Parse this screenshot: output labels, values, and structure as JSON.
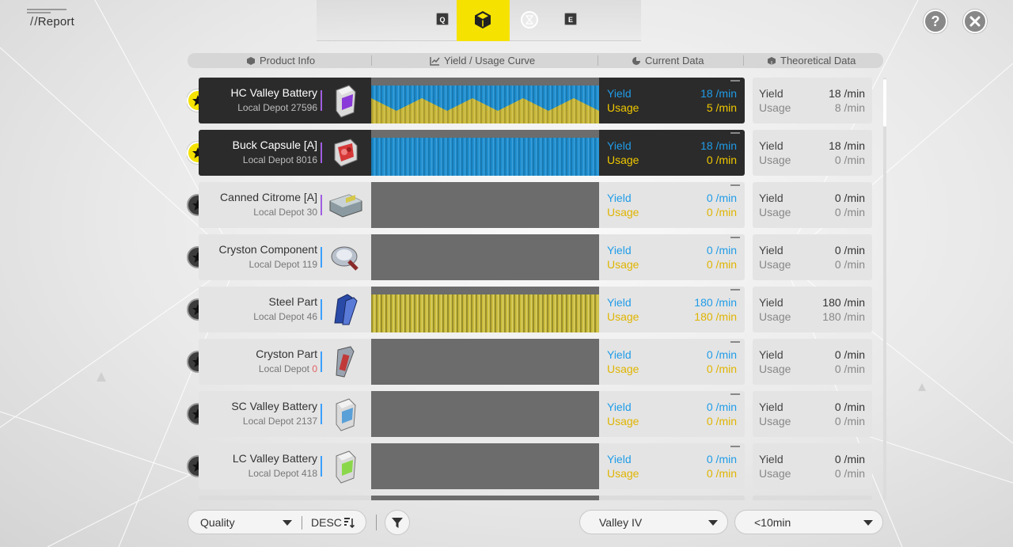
{
  "header": {
    "title": "/Report",
    "tabs": [
      {
        "key": "Q",
        "icon": "key-hint-q"
      },
      {
        "icon": "cube-icon",
        "active": true
      },
      {
        "icon": "hourglass-icon"
      },
      {
        "key": "E",
        "icon": "key-hint-e"
      }
    ],
    "help_label": "?"
  },
  "columns": {
    "product_info": "Product Info",
    "curve": "Yield / Usage Curve",
    "current": "Current Data",
    "theoretical": "Theoretical Data"
  },
  "labels": {
    "yield": "Yield",
    "usage": "Usage"
  },
  "rows": [
    {
      "name": "HC Valley Battery",
      "depot_prefix": "Local Depot ",
      "depot_count": "27596",
      "cur_yield": "18 /min",
      "cur_usage": "5 /min",
      "theo_yield": "18 /min",
      "theo_usage": "8 /min",
      "favorite": true,
      "dark": true,
      "curve": "yield_usage_wave",
      "accent": "purple",
      "icon": "battery-icon"
    },
    {
      "name": "Buck Capsule [A]",
      "depot_prefix": "Local Depot ",
      "depot_count": "8016",
      "cur_yield": "18 /min",
      "cur_usage": "0 /min",
      "theo_yield": "18 /min",
      "theo_usage": "0 /min",
      "favorite": true,
      "dark": true,
      "curve": "yield_only",
      "accent": "purple",
      "icon": "capsule-icon"
    },
    {
      "name": "Canned Citrome [A]",
      "depot_prefix": "Local Depot ",
      "depot_count": "30",
      "cur_yield": "0 /min",
      "cur_usage": "0 /min",
      "theo_yield": "0 /min",
      "theo_usage": "0 /min",
      "favorite": false,
      "dark": false,
      "curve": "none",
      "accent": "purple",
      "icon": "canned-food-icon"
    },
    {
      "name": "Cryston Component",
      "depot_prefix": "Local Depot ",
      "depot_count": "119",
      "cur_yield": "0 /min",
      "cur_usage": "0 /min",
      "theo_yield": "0 /min",
      "theo_usage": "0 /min",
      "favorite": false,
      "dark": false,
      "curve": "none",
      "accent": "blue",
      "icon": "component-icon"
    },
    {
      "name": "Steel Part",
      "depot_prefix": "Local Depot ",
      "depot_count": "46",
      "cur_yield": "180 /min",
      "cur_usage": "180 /min",
      "theo_yield": "180 /min",
      "theo_usage": "180 /min",
      "favorite": false,
      "dark": false,
      "curve": "usage_only",
      "accent": "blue",
      "icon": "steel-part-icon"
    },
    {
      "name": "Cryston Part",
      "depot_prefix": "Local Depot ",
      "depot_count": "0",
      "depot_warning": true,
      "cur_yield": "0 /min",
      "cur_usage": "0 /min",
      "theo_yield": "0 /min",
      "theo_usage": "0 /min",
      "favorite": false,
      "dark": false,
      "curve": "none",
      "accent": "blue",
      "icon": "cryston-part-icon"
    },
    {
      "name": "SC Valley Battery",
      "depot_prefix": "Local Depot ",
      "depot_count": "2137",
      "cur_yield": "0 /min",
      "cur_usage": "0 /min",
      "theo_yield": "0 /min",
      "theo_usage": "0 /min",
      "favorite": false,
      "dark": false,
      "curve": "none",
      "accent": "blue",
      "icon": "battery-icon"
    },
    {
      "name": "LC Valley Battery",
      "depot_prefix": "Local Depot ",
      "depot_count": "418",
      "cur_yield": "0 /min",
      "cur_usage": "0 /min",
      "theo_yield": "0 /min",
      "theo_usage": "0 /min",
      "favorite": false,
      "dark": false,
      "curve": "none",
      "accent": "blue",
      "icon": "battery-icon"
    }
  ],
  "footer": {
    "sort_by": "Quality",
    "sort_dir": "DESC",
    "region": "Valley IV",
    "time_range": "<10min"
  },
  "colors": {
    "accent": "#f5e200",
    "yield": "#1f9ce8",
    "usage": "#e0b400",
    "dark_card": "#2b2b2b",
    "light_card": "#e4e4e4"
  }
}
